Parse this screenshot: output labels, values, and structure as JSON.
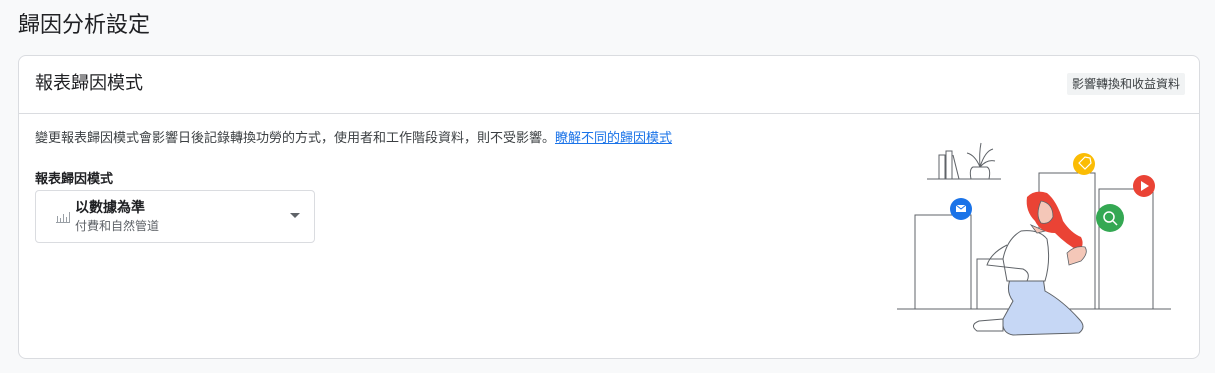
{
  "page": {
    "title": "歸因分析設定"
  },
  "card": {
    "title": "報表歸因模式",
    "chip_label": "影響轉換和收益資料",
    "description": "變更報表歸因模式會影響日後記錄轉換功勞的方式，使用者和工作階段資料，則不受影響。",
    "learn_more_link": "瞭解不同的歸因模式",
    "field_label": "報表歸因模式",
    "select": {
      "value": "以數據為準",
      "subtext": "付費和自然管道",
      "icon": "bar-chart-icon"
    }
  },
  "illustration": {
    "icons": [
      "mail-icon",
      "tag-icon",
      "search-icon",
      "play-icon"
    ]
  },
  "colors": {
    "link": "#1a73e8",
    "mail": "#1a73e8",
    "tag": "#fbbc04",
    "search": "#34a853",
    "play": "#ea4335",
    "hair": "#ea4335",
    "pants": "#c6d7f5"
  }
}
